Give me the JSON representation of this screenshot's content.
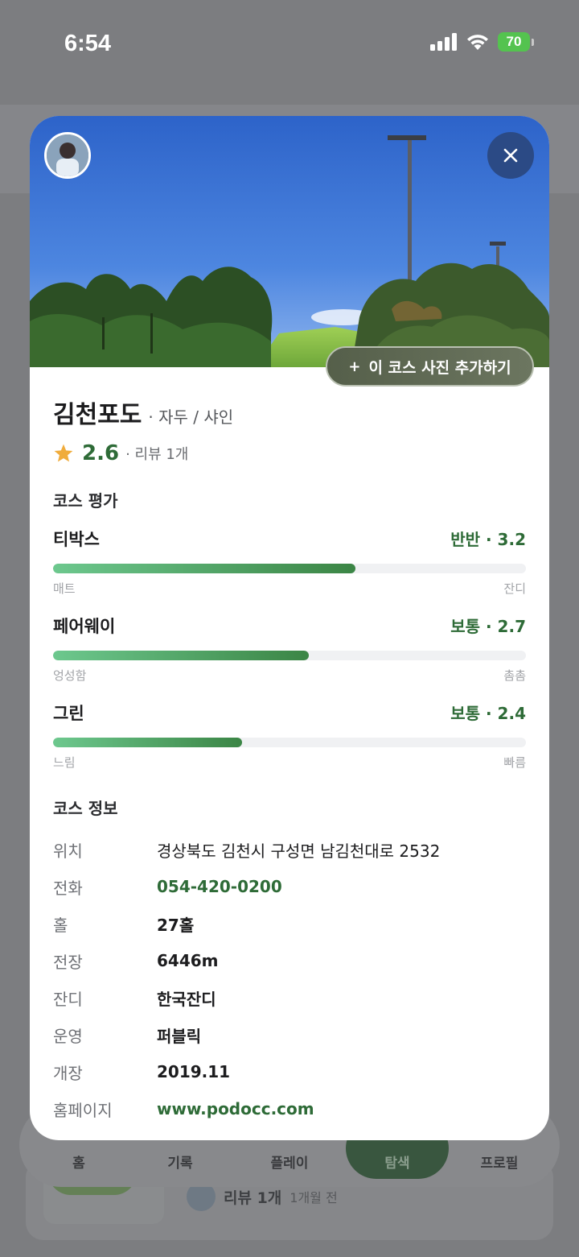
{
  "status_bar": {
    "time": "6:54",
    "battery": "70"
  },
  "background": {
    "tabs": [
      {
        "label": "홈"
      },
      {
        "label": "기록"
      },
      {
        "label": "플레이"
      },
      {
        "label": "탐색",
        "active": true
      },
      {
        "label": "프로필"
      }
    ],
    "review": {
      "count": "리뷰 1개",
      "time": "1개월 전"
    }
  },
  "modal": {
    "add_photo_label": "이 코스 사진 추가하기",
    "course": {
      "name": "김천포도",
      "sub": "· 자두 / 샤인",
      "rating": "2.6",
      "review_count": "· 리뷰 1개"
    },
    "evaluation": {
      "title": "코스 평가",
      "items": [
        {
          "label": "티박스",
          "score_text": "반반 · 3.2",
          "value": 3.2,
          "max": 5,
          "fill_ratio": 0.64,
          "left_end": "매트",
          "right_end": "잔디"
        },
        {
          "label": "페어웨이",
          "score_text": "보통 · 2.7",
          "value": 2.7,
          "max": 5,
          "fill_ratio": 0.54,
          "left_end": "엉성함",
          "right_end": "촘촘"
        },
        {
          "label": "그린",
          "score_text": "보통 · 2.4",
          "value": 2.4,
          "max": 5,
          "fill_ratio": 0.4,
          "left_end": "느림",
          "right_end": "빠름"
        }
      ]
    },
    "info": {
      "title": "코스 정보",
      "rows": [
        {
          "key": "위치",
          "value": "경상북도 김천시 구성면 남김천대로 2532",
          "style": "plain"
        },
        {
          "key": "전화",
          "value": "054-420-0200",
          "style": "link"
        },
        {
          "key": "홀",
          "value": "27홀",
          "style": "strong"
        },
        {
          "key": "전장",
          "value": "6446m",
          "style": "strong"
        },
        {
          "key": "잔디",
          "value": "한국잔디",
          "style": "strong"
        },
        {
          "key": "운영",
          "value": "퍼블릭",
          "style": "strong"
        },
        {
          "key": "개장",
          "value": "2019.11",
          "style": "strong"
        },
        {
          "key": "홈페이지",
          "value": "www.podocc.com",
          "style": "link"
        }
      ]
    }
  },
  "colors": {
    "accent_green": "#2e6b37",
    "close_button": "#2b4a85",
    "star": "#f0ac3c",
    "battery": "#54c34f"
  },
  "icons": [
    "close-icon",
    "star-icon",
    "plus-icon",
    "signal-icon",
    "wifi-icon",
    "battery-icon"
  ]
}
